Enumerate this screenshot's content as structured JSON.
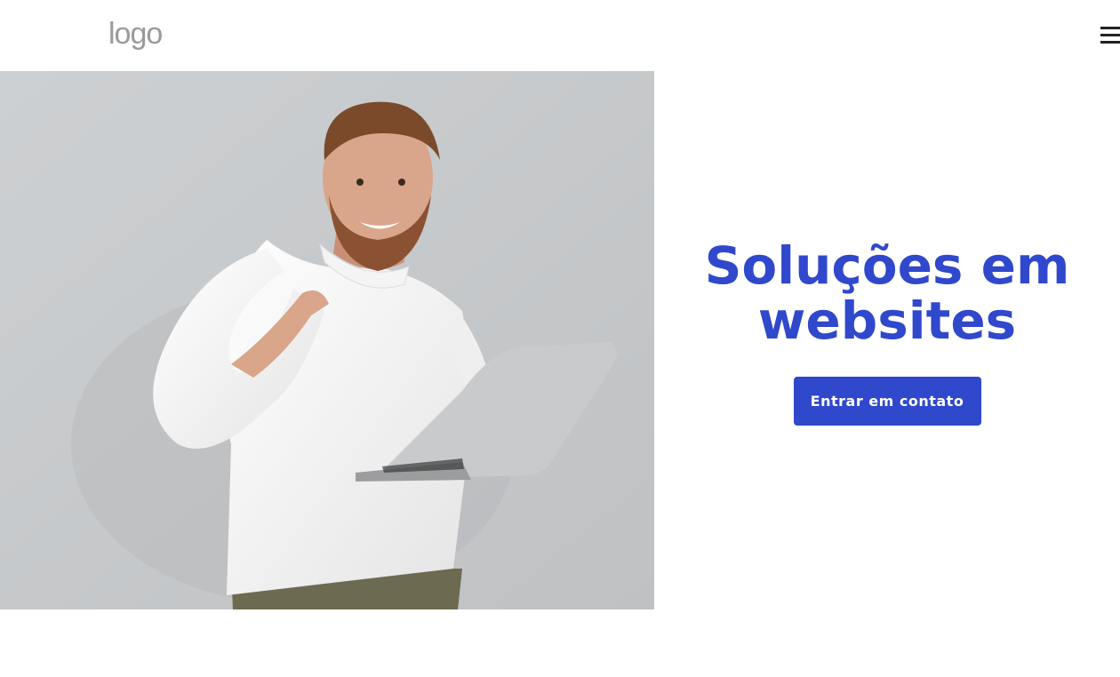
{
  "header": {
    "logo_text": "logo",
    "menu_icon": "hamburger-menu-icon"
  },
  "hero": {
    "image_description_icon": "hero-photo",
    "title": "Soluções em websites",
    "cta_label": "Entrar em contato"
  },
  "colors": {
    "accent": "#2f48cc",
    "photo_background": "#c7c9cb",
    "logo_gray": "#9a9a9a"
  }
}
